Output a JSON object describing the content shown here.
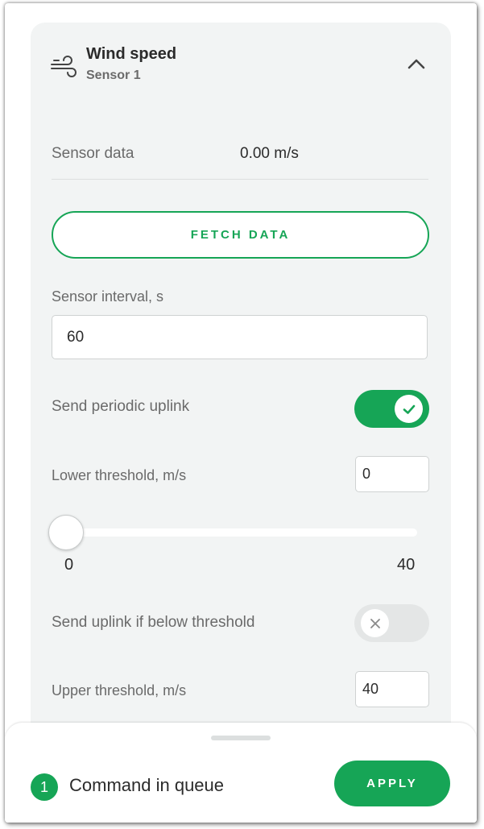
{
  "card": {
    "title": "Wind speed",
    "subtitle": "Sensor 1",
    "icon": "wind-icon",
    "collapse_icon": "chevron-up-icon"
  },
  "sensor_data": {
    "label": "Sensor data",
    "value": "0.00 m/s"
  },
  "fetch_button": {
    "label": "FETCH DATA"
  },
  "sensor_interval": {
    "label": "Sensor interval, s",
    "value": "60"
  },
  "periodic_uplink": {
    "label": "Send periodic uplink",
    "enabled": true
  },
  "lower_threshold": {
    "label": "Lower threshold, m/s",
    "value": "0",
    "slider": {
      "min_label": "0",
      "max_label": "40",
      "current": 0
    }
  },
  "below_threshold_uplink": {
    "label": "Send uplink if below threshold",
    "enabled": false
  },
  "upper_threshold": {
    "label": "Upper threshold, m/s",
    "value": "40"
  },
  "footer": {
    "queue_count": "1",
    "queue_text": "Command in queue",
    "apply_label": "APPLY"
  },
  "colors": {
    "accent": "#16a556",
    "card_bg": "#f2f4f4",
    "text_primary": "#2b2b2b",
    "text_secondary": "#6a6a6a"
  }
}
